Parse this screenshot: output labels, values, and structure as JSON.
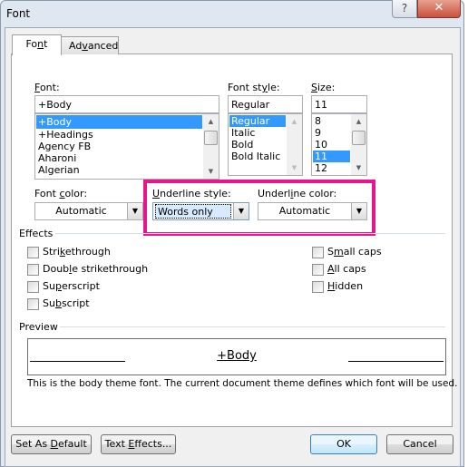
{
  "window": {
    "title": "Font",
    "help_label": "?",
    "close_label": "✕"
  },
  "tabs": [
    {
      "label_pre": "Fo",
      "label_key": "n",
      "label_post": "t",
      "active": true
    },
    {
      "label_pre": "Ad",
      "label_key": "v",
      "label_post": "anced",
      "active": false
    }
  ],
  "font": {
    "label_key": "F",
    "label_post": "ont:",
    "value": "+Body",
    "items": [
      "+Body",
      "+Headings",
      "Agency FB",
      "Aharoni",
      "Algerian"
    ],
    "selected": "+Body"
  },
  "font_style": {
    "label_pre": "Font st",
    "label_key": "y",
    "label_post": "le:",
    "value": "Regular",
    "items": [
      "Regular",
      "Italic",
      "Bold",
      "Bold Italic"
    ],
    "selected": "Regular"
  },
  "size": {
    "label_key": "S",
    "label_post": "ize:",
    "value": "11",
    "items": [
      "8",
      "9",
      "10",
      "11",
      "12"
    ],
    "selected": "11"
  },
  "font_color": {
    "label_pre": "Font ",
    "label_key": "c",
    "label_post": "olor:",
    "value": "Automatic"
  },
  "underline_style": {
    "label_key": "U",
    "label_post": "nderline style:",
    "value": "Words only"
  },
  "underline_color": {
    "label_pre": "Underl",
    "label_key": "i",
    "label_post": "ne color:",
    "value": "Automatic"
  },
  "highlight_color": "#e8168c",
  "effects": {
    "label": "Effects",
    "left": [
      {
        "pre": "Stri",
        "key": "k",
        "post": "ethrough",
        "checked": false
      },
      {
        "pre": "Doub",
        "key": "l",
        "post": "e strikethrough",
        "checked": false
      },
      {
        "pre": "Su",
        "key": "p",
        "post": "erscript",
        "checked": false
      },
      {
        "pre": "Su",
        "key": "b",
        "post": "script",
        "checked": false
      }
    ],
    "right": [
      {
        "pre": "S",
        "key": "m",
        "post": "all caps",
        "checked": false
      },
      {
        "pre": "",
        "key": "A",
        "post": "ll caps",
        "checked": false
      },
      {
        "pre": "",
        "key": "H",
        "post": "idden",
        "checked": false
      }
    ]
  },
  "preview": {
    "label": "Preview",
    "sample": "+Body",
    "description": "This is the body theme font. The current document theme defines which font will be used."
  },
  "buttons": {
    "default_pre": "Set As ",
    "default_key": "D",
    "default_post": "efault",
    "effects_pre": "Text ",
    "effects_key": "E",
    "effects_post": "ffects...",
    "ok": "OK",
    "cancel": "Cancel"
  }
}
